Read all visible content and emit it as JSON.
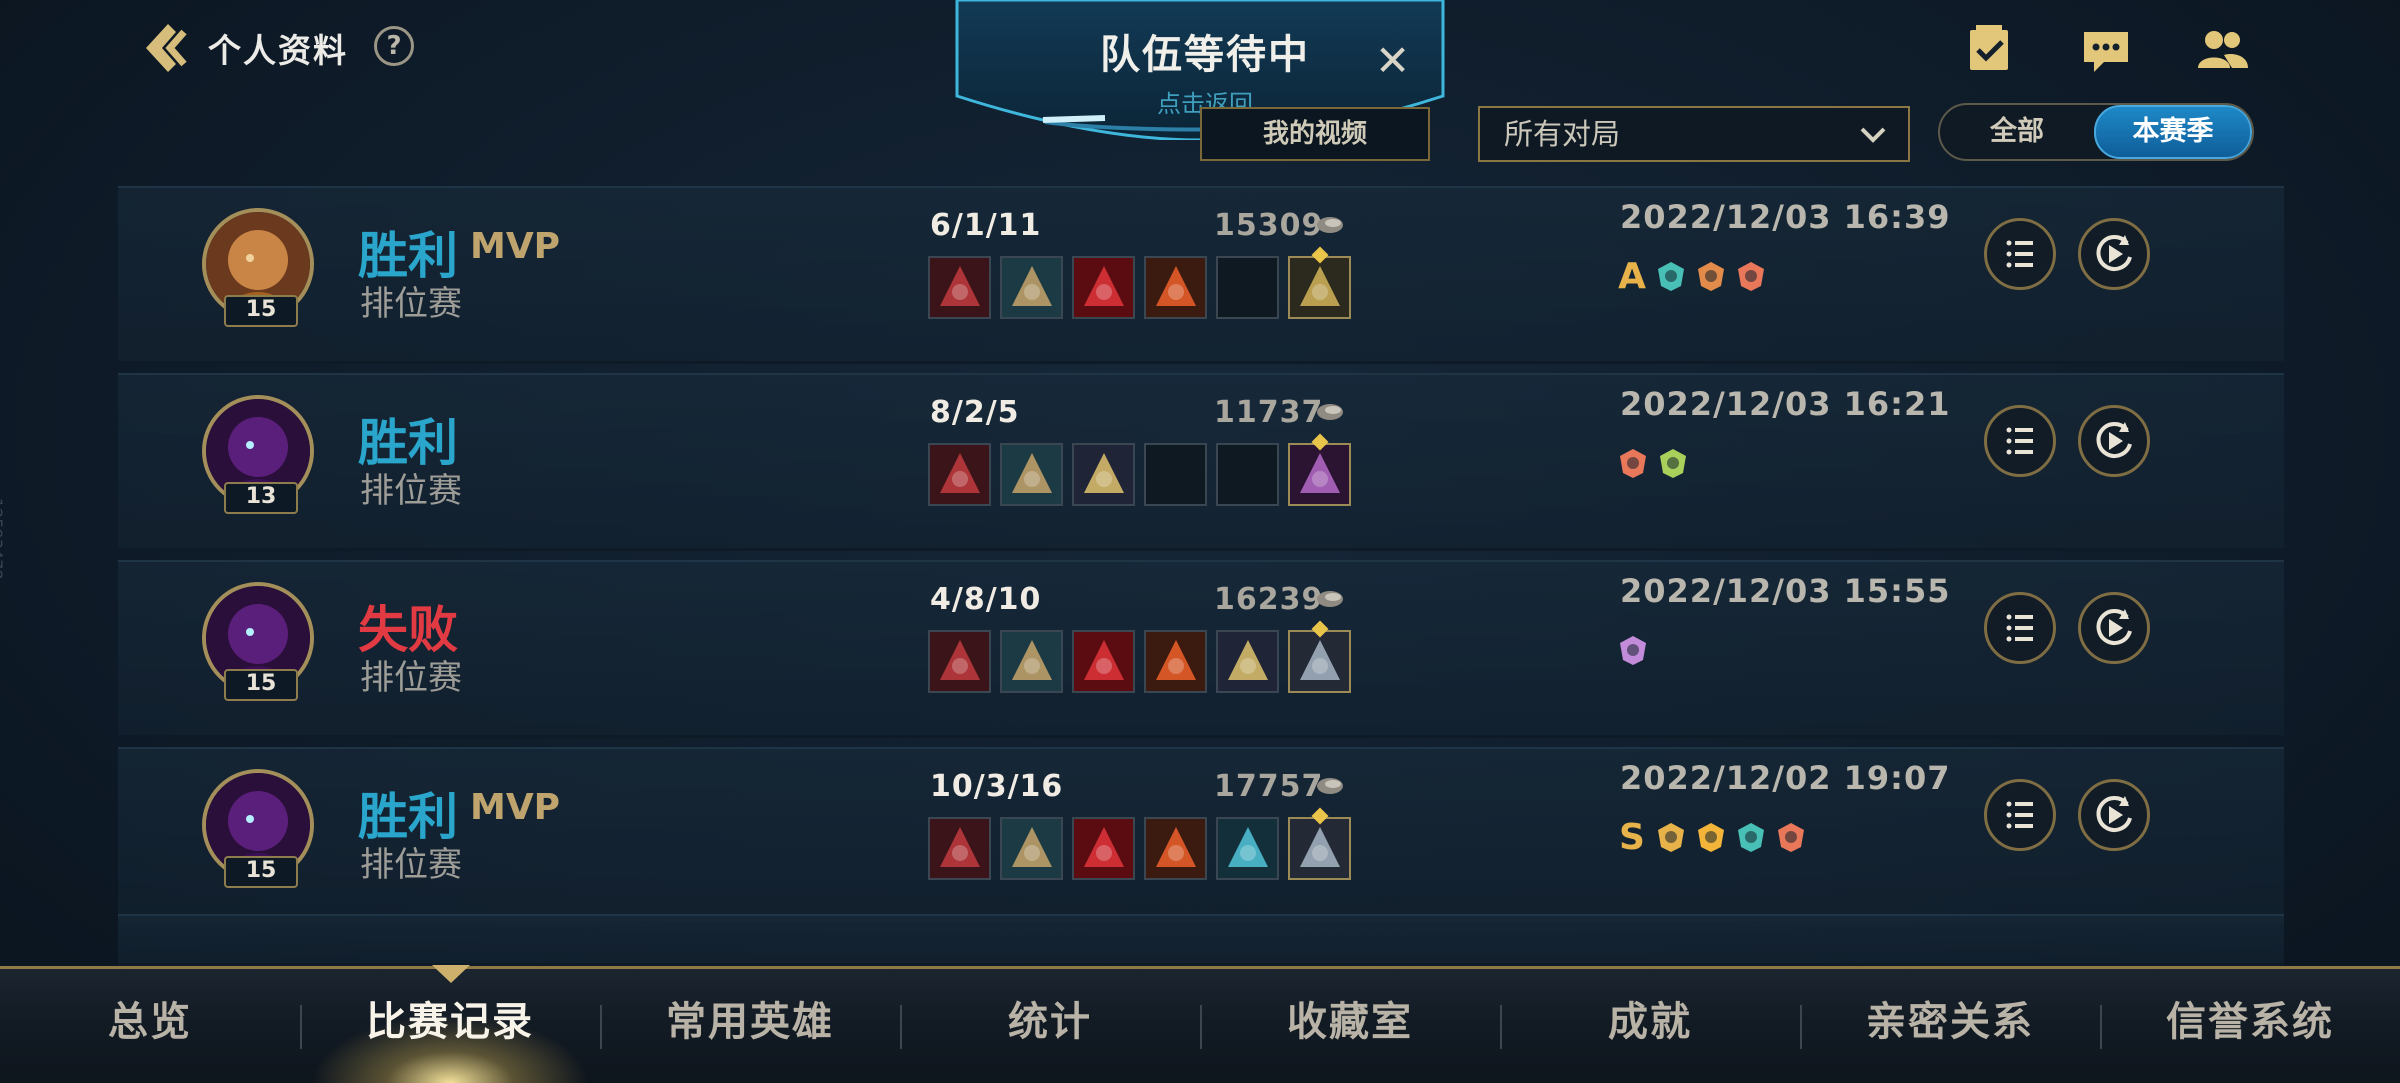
{
  "header": {
    "title": "个人资料",
    "help": "?",
    "icons": [
      "checklist-icon",
      "chat-icon",
      "friends-icon"
    ]
  },
  "queue": {
    "title": "队伍等待中",
    "subtitle": "点击返回"
  },
  "toolbar": {
    "video_button": "我的视频",
    "filter_select": "所有对局",
    "season_toggle": [
      "全部",
      "本赛季"
    ],
    "season_selected": "本赛季"
  },
  "matches": [
    {
      "result": "胜利",
      "outcome": "win",
      "mvp": "MVP",
      "mode": "排位赛",
      "level": "15",
      "kda": "6/1/11",
      "score": "15309",
      "datetime": "2022/12/03 16:39",
      "badge_letter": "A",
      "items": [
        "blade",
        "gauntlet",
        "claw",
        "flame",
        "",
        "armor"
      ]
    },
    {
      "result": "胜利",
      "outcome": "win",
      "mvp": "",
      "mode": "排位赛",
      "level": "13",
      "kda": "8/2/5",
      "score": "11737",
      "datetime": "2022/12/03 16:21",
      "badge_letter": "",
      "items": [
        "blade",
        "gauntlet",
        "star",
        "",
        "",
        "boots"
      ]
    },
    {
      "result": "失败",
      "outcome": "lose",
      "mvp": "",
      "mode": "排位赛",
      "level": "15",
      "kda": "4/8/10",
      "score": "16239",
      "datetime": "2022/12/03 15:55",
      "badge_letter": "",
      "items": [
        "blade",
        "gauntlet",
        "claw",
        "flame",
        "star",
        "helm"
      ]
    },
    {
      "result": "胜利",
      "outcome": "win",
      "mvp": "MVP",
      "mode": "排位赛",
      "level": "15",
      "kda": "10/3/16",
      "score": "17757",
      "datetime": "2022/12/02 19:07",
      "badge_letter": "S",
      "items": [
        "blade",
        "gauntlet",
        "claw",
        "flame",
        "scale",
        "helm"
      ]
    }
  ],
  "nav": {
    "items": [
      "总览",
      "比赛记录",
      "常用英雄",
      "统计",
      "收藏室",
      "成就",
      "亲密关系",
      "信誉系统"
    ],
    "active": "比赛记录"
  },
  "side_tag": "12593478",
  "colors": {
    "win": "#2aa6cc",
    "lose": "#e23a43",
    "gold": "#bfa46e",
    "accent_blue": "#1e88c7"
  }
}
